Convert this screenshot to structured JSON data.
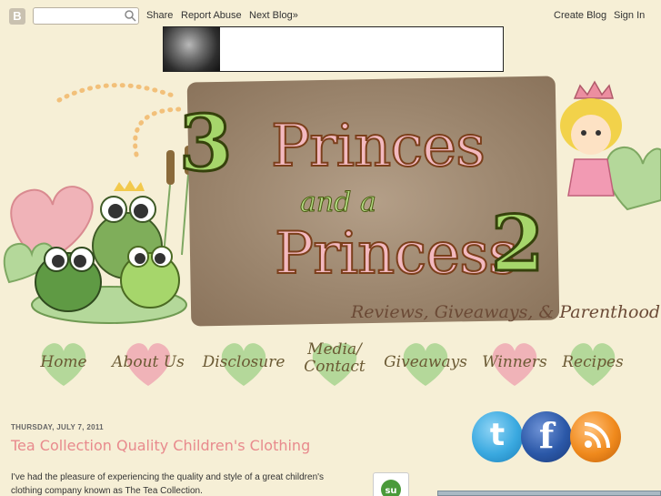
{
  "navbar": {
    "search": {
      "value": "",
      "placeholder": ""
    },
    "share": "Share",
    "report_abuse": "Report Abuse",
    "next_blog": "Next Blog»",
    "create_blog": "Create Blog",
    "sign_in": "Sign In"
  },
  "header": {
    "title_line1_num": "3",
    "title_line1": "Princes",
    "title_and": "and a",
    "title_line2": "Princess",
    "title_line2_num": "2",
    "tagline": "Reviews, Giveaways, & Parenthood"
  },
  "menu": {
    "items": [
      {
        "label": "Home"
      },
      {
        "label": "About Us"
      },
      {
        "label": "Disclosure"
      },
      {
        "label": "Media/\nContact"
      },
      {
        "label": "Giveaways"
      },
      {
        "label": "Winners"
      },
      {
        "label": "Recipes"
      }
    ]
  },
  "post": {
    "date": "THURSDAY, JULY 7, 2011",
    "title": "Tea Collection Quality Children's Clothing",
    "body": "I've had the pleasure of experiencing the quality and style of a great children's clothing company known as The Tea Collection."
  },
  "social": {
    "twitter": "t",
    "facebook": "f"
  },
  "colors": {
    "background": "#f6efd6",
    "title_pink": "#e88a8d",
    "heart_green": "#b4d89a",
    "heart_pink": "#f0b3b8",
    "twitter": "#3aa9e0",
    "facebook": "#2b58a8",
    "rss": "#f08a1d"
  }
}
